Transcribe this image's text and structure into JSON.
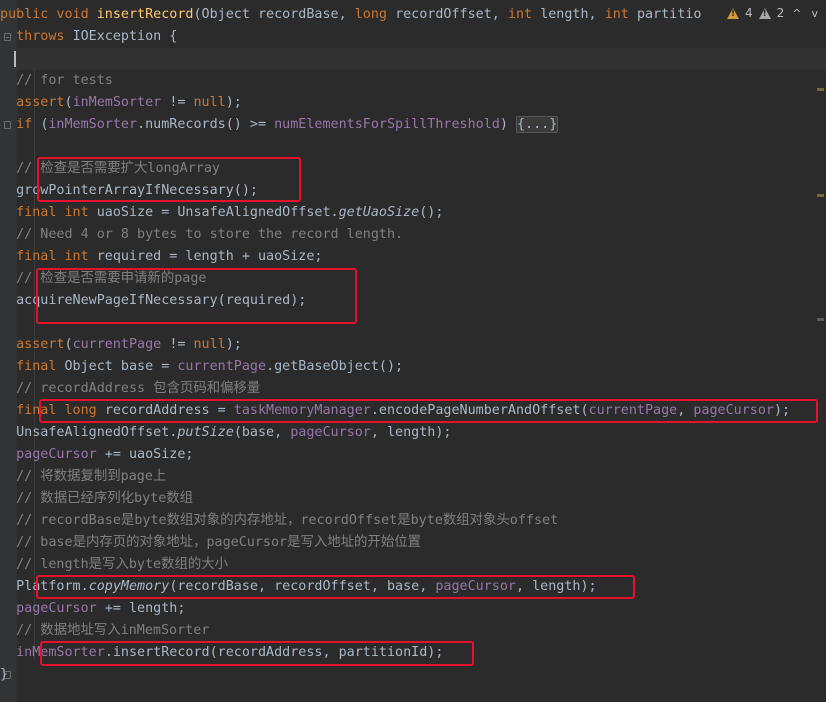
{
  "status": {
    "warnings": "4",
    "weak_warnings": "2",
    "prev_label": "^",
    "next_label": "v"
  },
  "code": {
    "l01": {
      "a": "public void ",
      "b": "insertRecord",
      "c": "(Object recordBase, ",
      "d": "long ",
      "e": "recordOffset, ",
      "f": "int ",
      "g": "length, ",
      "h": "int ",
      "i": "partitio"
    },
    "l02": {
      "a": "  ",
      "b": "throws ",
      "c": "IOException {"
    },
    "l04": {
      "a": "  ",
      "b": "// for tests"
    },
    "l05": {
      "a": "  ",
      "b": "assert",
      "c": "(",
      "d": "inMemSorter ",
      "e": "!= ",
      "f": "null",
      "g": ");"
    },
    "l06": {
      "a": "  ",
      "b": "if ",
      "c": "(",
      "d": "inMemSorter",
      "e": ".numRecords() >= ",
      "f": "numElementsForSpillThreshold",
      "g": ") ",
      "h": "{...}"
    },
    "l08": {
      "a": "  ",
      "b": "// 检查是否需要扩大longArray"
    },
    "l09": {
      "a": "  ",
      "b": "growPointerArrayIfNecessary();"
    },
    "l10": {
      "a": "  ",
      "b": "final int ",
      "c": "uaoSize = UnsafeAlignedOffset.",
      "d": "getUaoSize",
      "e": "();"
    },
    "l11": {
      "a": "  ",
      "b": "// Need 4 or 8 bytes to store the record length."
    },
    "l12": {
      "a": "  ",
      "b": "final int ",
      "c": "required = length + uaoSize;"
    },
    "l13": {
      "a": "  ",
      "b": "// 检查是否需要申请新的page"
    },
    "l14": {
      "a": "  ",
      "b": "acquireNewPageIfNecessary(required);"
    },
    "l16": {
      "a": "  ",
      "b": "assert",
      "c": "(",
      "d": "currentPage ",
      "e": "!= ",
      "f": "null",
      "g": ");"
    },
    "l17": {
      "a": "  ",
      "b": "final ",
      "c": "Object base = ",
      "d": "currentPage",
      "e": ".getBaseObject();"
    },
    "l18": {
      "a": "  ",
      "b": "// recordAddress 包含页码和偏移量"
    },
    "l19": {
      "a": "  ",
      "b": "final long ",
      "c": "recordAddress = ",
      "d": "taskMemoryManager",
      "e": ".encodePageNumberAndOffset(",
      "f": "currentPage",
      "g": ", ",
      "h": "pageCursor",
      "i": ");"
    },
    "l20": {
      "a": "  ",
      "b": "UnsafeAlignedOffset.",
      "c": "putSize",
      "d": "(base, ",
      "e": "pageCursor",
      "f": ", length);"
    },
    "l21": {
      "a": "  ",
      "b": "pageCursor ",
      "c": "+= uaoSize;"
    },
    "l22": {
      "a": "  ",
      "b": "// 将数据复制到page上"
    },
    "l23": {
      "a": "  ",
      "b": "// 数据已经序列化byte数组"
    },
    "l24": {
      "a": "  ",
      "b": "// recordBase是byte数组对象的内存地址，recordOffset是byte数组对象头offset"
    },
    "l25": {
      "a": "  ",
      "b": "// base是内存页的对象地址，pageCursor是写入地址的开始位置"
    },
    "l26": {
      "a": "  ",
      "b": "// length是写入byte数组的大小"
    },
    "l27": {
      "a": "  ",
      "b": "Platform.",
      "c": "copyMemory",
      "d": "(recordBase, recordOffset, base, ",
      "e": "pageCursor",
      "f": ", length);"
    },
    "l28": {
      "a": "  ",
      "b": "pageCursor ",
      "c": "+= length;"
    },
    "l29": {
      "a": "  ",
      "b": "// 数据地址写入inMemSorter"
    },
    "l30": {
      "a": "  ",
      "b": "inMemSorter",
      "c": ".insertRecord(recordAddress, partitionId);"
    },
    "l31": {
      "a": "}"
    }
  },
  "colors": {
    "background": "#2b2b2b",
    "keyword": "#cc7832",
    "method_decl": "#ffc66d",
    "comment": "#808080",
    "field": "#9876aa",
    "plain": "#a9b7c6",
    "highlight_box": "#e8112d"
  }
}
